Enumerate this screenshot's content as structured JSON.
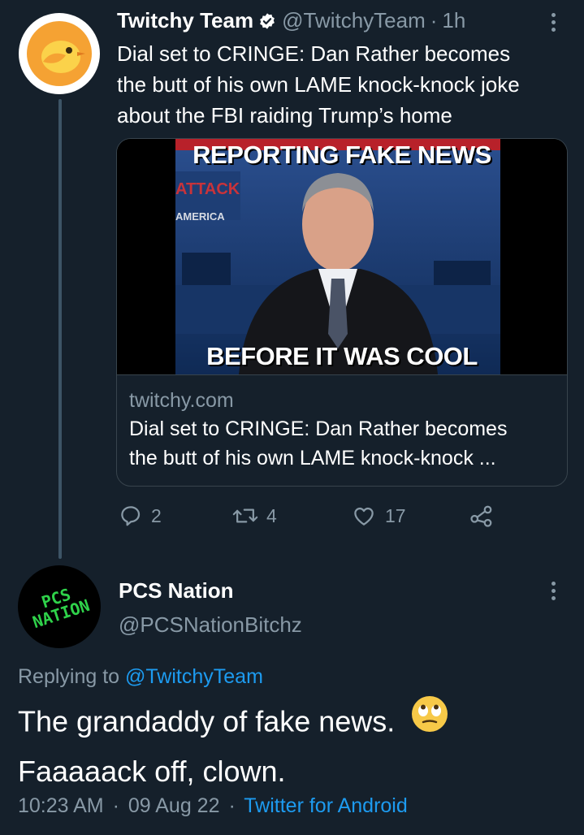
{
  "tweet": {
    "author_name": "Twitchy Team",
    "author_handle": "@TwitchyTeam",
    "separator": "·",
    "time_ago": "1h",
    "text_lines": [
      "Dial set to CRINGE: Dan Rather becomes",
      "the butt of his own LAME knock-knock joke",
      "about the FBI raiding Trump’s home"
    ],
    "card": {
      "image_top_text": "REPORTING FAKE NEWS",
      "image_bottom_text": "BEFORE IT WAS COOL",
      "image_side_text_1": "ATTACK",
      "image_side_text_2": "AMERICA",
      "domain": "twitchy.com",
      "title_line_1": "Dial set to CRINGE: Dan Rather becomes",
      "title_line_2": "the butt of his own LAME knock-knock ..."
    },
    "actions": {
      "reply_count": "2",
      "retweet_count": "4",
      "like_count": "17"
    },
    "icons": [
      "verified-badge-icon",
      "more-icon",
      "reply-icon",
      "retweet-icon",
      "like-icon",
      "share-icon"
    ]
  },
  "reply": {
    "author_name": "PCS Nation",
    "author_handle": "@PCSNationBitchz",
    "avatar_text_1": "PCS",
    "avatar_text_2": "NATION",
    "replying_prefix": "Replying to",
    "replying_to": "@TwitchyTeam",
    "text_line_1": "The grandaddy of fake news.",
    "text_line_2": "Faaaaack off, clown.",
    "emoji": "🙄",
    "time": "10:23 AM",
    "sep": "·",
    "date": "09 Aug 22",
    "sep2": "·",
    "source": "Twitter for Android"
  },
  "colors": {
    "background": "#15202b",
    "secondary_text": "#8899a6",
    "link": "#1d9bf0"
  }
}
